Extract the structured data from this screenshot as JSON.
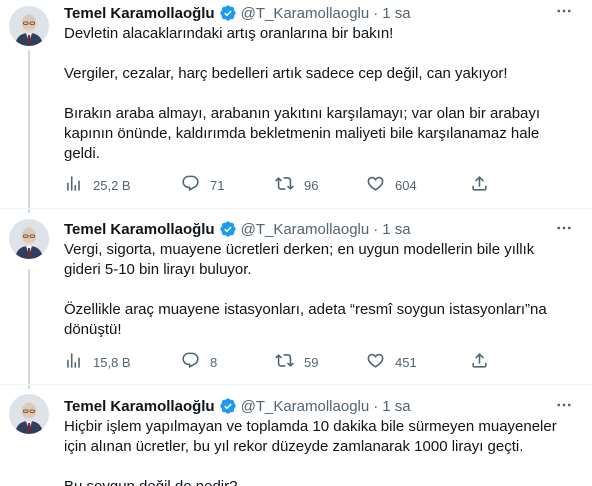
{
  "tweets": [
    {
      "name": "Temel Karamollaoğlu",
      "handle": "@T_Karamollaoglu",
      "dot": "·",
      "time": "1 sa",
      "paragraphs": [
        "Devletin alacaklarındaki artış oranlarına bir bakın!",
        "Vergiler, cezalar, harç bedelleri artık sadece cep değil, can yakıyor!",
        "Bırakın araba almayı, arabanın yakıtını karşılamayı; var olan bir arabayı kapının önünde, kaldırımda bekletmenin maliyeti bile karşılanamaz hale geldi."
      ],
      "views": "25,2 B",
      "replies": "71",
      "retweets": "96",
      "likes": "604"
    },
    {
      "name": "Temel Karamollaoğlu",
      "handle": "@T_Karamollaoglu",
      "dot": "·",
      "time": "1 sa",
      "paragraphs": [
        "Vergi, sigorta, muayene ücretleri derken; en uygun modellerin bile yıllık gideri 5-10 bin lirayı buluyor.",
        "Özellikle araç muayene istasyonları, adeta “resmî soygun istasyonları”na dönüştü!"
      ],
      "views": "15,8 B",
      "replies": "8",
      "retweets": "59",
      "likes": "451"
    },
    {
      "name": "Temel Karamollaoğlu",
      "handle": "@T_Karamollaoglu",
      "dot": "·",
      "time": "1 sa",
      "paragraphs": [
        "Hiçbir işlem yapılmayan ve toplamda 10 dakika bile sürmeyen muayeneler için alınan ücretler, bu yıl rekor düzeyde zamlanarak 1000 lirayı geçti.",
        "Bu soygun değil de nedir?"
      ]
    }
  ],
  "icons": {
    "verified": "verified-badge-icon",
    "more": "more-options-icon",
    "views": "views-icon",
    "reply": "reply-icon",
    "retweet": "retweet-icon",
    "like": "like-icon",
    "share": "share-icon"
  },
  "colors": {
    "verified": "#1d9bf0",
    "text": "#0f1419",
    "secondary": "#536471",
    "thread_line": "#cfd9de"
  }
}
